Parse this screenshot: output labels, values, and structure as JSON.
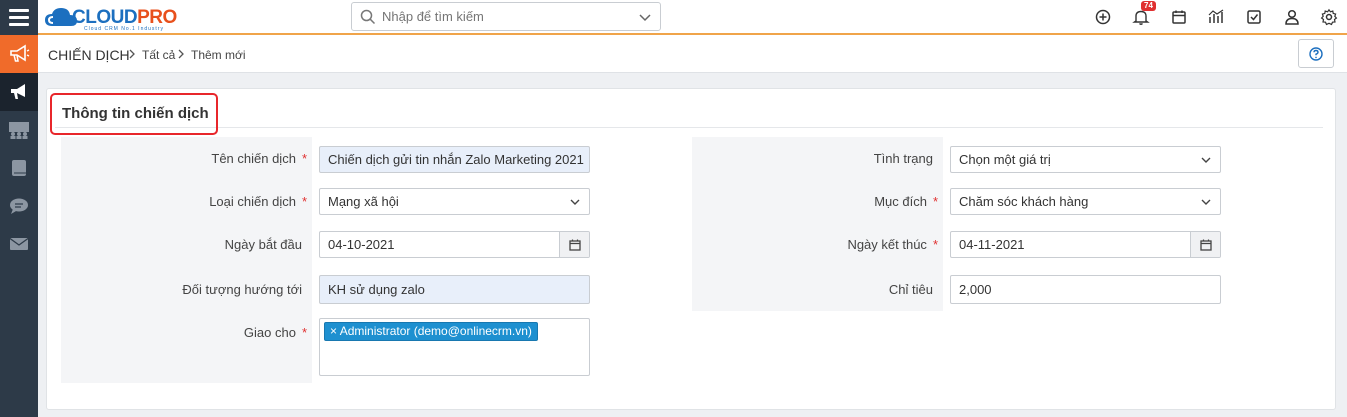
{
  "app": {
    "logo_text_part1": "CLOUD",
    "logo_text_part2": "PRO",
    "logo_subtitle": "Cloud CRM No.1 Industry",
    "brand_blue": "#1c6fbf",
    "brand_orange": "#e8501c"
  },
  "search": {
    "placeholder": "Nhập để tìm kiếm"
  },
  "header_icons": [
    "plus-circle-icon",
    "bell-icon",
    "calendar-icon",
    "chart-icon",
    "checkbox-icon",
    "user-icon",
    "gear-icon"
  ],
  "notifications": {
    "count": "74"
  },
  "sidebar": {
    "items": [
      "megaphone-icon",
      "campaign-icon",
      "users-icon",
      "book-icon",
      "chat-icon",
      "mail-icon"
    ]
  },
  "breadcrumb": {
    "module": "CHIẾN DỊCH",
    "level1": "Tất cả",
    "level2": "Thêm mới"
  },
  "section": {
    "title": "Thông tin chiến dịch"
  },
  "form": {
    "campaign_name_label": "Tên chiến dịch",
    "campaign_name_value": "Chiến dịch gửi tin nhắn Zalo Marketing 2021",
    "campaign_type_label": "Loại chiến dịch",
    "campaign_type_value": "Mạng xã hội",
    "start_date_label": "Ngày bắt đầu",
    "start_date_value": "04-10-2021",
    "target_label": "Đối tượng hướng tới",
    "target_value": "KH sử dụng zalo",
    "assigned_label": "Giao cho",
    "assigned_tag": "Administrator (demo@onlinecrm.vn)",
    "status_label": "Tình trạng",
    "status_value": "Chọn một giá trị",
    "purpose_label": "Mục đích",
    "purpose_value": "Chăm sóc khách hàng",
    "end_date_label": "Ngày kết thúc",
    "end_date_value": "04-11-2021",
    "quota_label": "Chỉ tiêu",
    "quota_value": "2,000",
    "required_mark": "*"
  }
}
